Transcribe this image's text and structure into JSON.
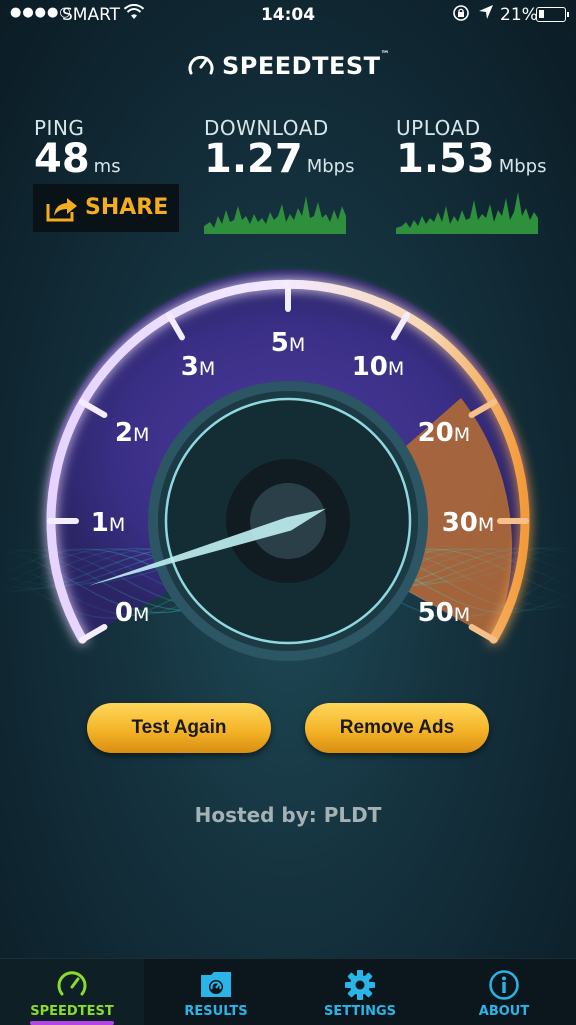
{
  "status_bar": {
    "signal": "●●●●○",
    "carrier": "SMART",
    "time": "14:04",
    "battery_text": "21%",
    "battery_level": 0.21
  },
  "header": {
    "title": "SPEEDTEST",
    "trademark": "™"
  },
  "ping": {
    "label": "PING",
    "value": "48",
    "unit": "ms"
  },
  "download": {
    "label": "DOWNLOAD",
    "value": "1.27",
    "unit": "Mbps"
  },
  "upload": {
    "label": "UPLOAD",
    "value": "1.53",
    "unit": "Mbps"
  },
  "share": {
    "label": "SHARE"
  },
  "gauge": {
    "ticks": [
      {
        "value": "0",
        "unit": "M"
      },
      {
        "value": "1",
        "unit": "M"
      },
      {
        "value": "2",
        "unit": "M"
      },
      {
        "value": "3",
        "unit": "M"
      },
      {
        "value": "5",
        "unit": "M"
      },
      {
        "value": "10",
        "unit": "M"
      },
      {
        "value": "20",
        "unit": "M"
      },
      {
        "value": "30",
        "unit": "M"
      },
      {
        "value": "50",
        "unit": "M"
      }
    ],
    "needle_value": 0.4
  },
  "actions": {
    "test_again": "Test Again",
    "remove_ads": "Remove Ads"
  },
  "hosted": "Hosted by: PLDT",
  "tabs": [
    {
      "label": "SPEEDTEST",
      "icon": "gauge-icon",
      "active": true
    },
    {
      "label": "RESULTS",
      "icon": "results-folder-icon",
      "active": false
    },
    {
      "label": "SETTINGS",
      "icon": "gear-icon",
      "active": false
    },
    {
      "label": "ABOUT",
      "icon": "info-icon",
      "active": false
    }
  ],
  "colors": {
    "accent_orange": "#f5ad20",
    "arc_purple": "#a45ef0",
    "arc_orange": "#f39a3a",
    "tab_blue": "#2ab4e8",
    "tab_green": "#8bdc2a"
  }
}
